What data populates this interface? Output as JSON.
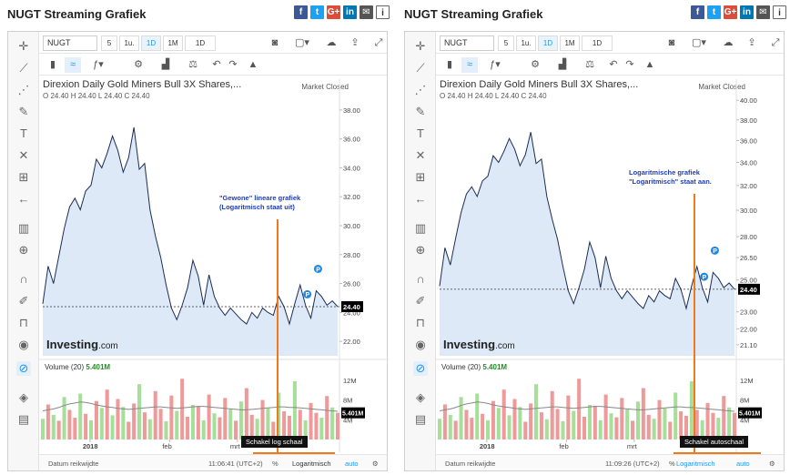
{
  "panels": [
    {
      "id": "left",
      "title": "NUGT Streaming Grafiek",
      "symbol": "NUGT",
      "timeframes": [
        "5",
        "1u.",
        "1D",
        "1M",
        "1D"
      ],
      "selected_timeframe_index": 2,
      "instrument_name": "Direxion Daily Gold Miners Bull 3X Shares,...",
      "ohlc_text": "O 24.40  H 24.40  L 24.40  C 24.40",
      "market_status": "Market Closed",
      "y_labels": [
        "38.00",
        "36.00",
        "34.00",
        "32.00",
        "30.00",
        "28.00",
        "26.00",
        "24.00",
        "22.00"
      ],
      "last_price": "24.40",
      "annotation_line1": "\"Gewone\" lineare grafiek",
      "annotation_line2": "(Logaritmisch staat uit)",
      "volume_label": "Volume (20)",
      "volume_value": "5.401M",
      "vol_axis_labels": [
        "12M",
        "8M",
        "4M"
      ],
      "x_labels": [
        "2018",
        "feb",
        "mrt"
      ],
      "range_label": "Datum reikwijdte",
      "time_label": "11:06:41 (UTC+2)",
      "percent_label": "%",
      "log_label": "Logaritmisch",
      "auto_label": "auto",
      "tooltip": "Schakel log schaal",
      "log_on": false
    },
    {
      "id": "right",
      "title": "NUGT Streaming Grafiek",
      "symbol": "NUGT",
      "timeframes": [
        "5",
        "1u.",
        "1D",
        "1M",
        "1D"
      ],
      "selected_timeframe_index": 2,
      "instrument_name": "Direxion Daily Gold Miners Bull 3X Shares,...",
      "ohlc_text": "O 24.40  H 24.40  L 24.40  C 24.40",
      "market_status": "Market Closed",
      "y_labels": [
        "40.00",
        "38.00",
        "36.00",
        "34.00",
        "32.00",
        "30.00",
        "28.00",
        "26.50",
        "25.00",
        "23.00",
        "22.00",
        "21.10"
      ],
      "last_price": "24.40",
      "annotation_line1": "Logaritmische grafiek",
      "annotation_line2": "\"Logaritmisch\" staat aan.",
      "volume_label": "Volume (20)",
      "volume_value": "5.401M",
      "vol_axis_labels": [
        "12M",
        "8M",
        "4M"
      ],
      "x_labels": [
        "2018",
        "feb",
        "mrt"
      ],
      "range_label": "Datum reikwijdte",
      "time_label": "11:09:26 (UTC+2)",
      "percent_label": "%",
      "log_label": "Logaritmisch",
      "auto_label": "auto",
      "tooltip": "Schakel autoschaal",
      "log_on": true
    }
  ],
  "brand": {
    "name": "Investing",
    "suffix": ".com"
  },
  "share_icons": [
    "facebook-icon",
    "twitter-icon",
    "google-plus-icon",
    "linkedin-icon",
    "mail-icon",
    "info-icon"
  ],
  "share_glyphs": [
    "f",
    "t",
    "G+",
    "in",
    "✉",
    "i"
  ],
  "colors": {
    "line": "#1b2d55",
    "area": "#dde9f7",
    "vol_up": "#a6df9a",
    "vol_down": "#ee9a9a",
    "highlight": "#f07a1a",
    "accent": "#2196f3"
  },
  "chart_data": [
    {
      "type": "line",
      "title": "Direxion Daily Gold Miners Bull 3X Shares,...",
      "scale": "linear",
      "ylim": [
        21,
        39
      ],
      "x_ticks": [
        "2018",
        "feb",
        "mrt"
      ],
      "values": [
        24.6,
        27.2,
        26.0,
        27.9,
        29.8,
        31.3,
        31.9,
        31.1,
        32.4,
        32.8,
        34.6,
        34.0,
        35.0,
        36.2,
        35.2,
        33.7,
        34.7,
        36.8,
        33.9,
        34.3,
        31.1,
        29.3,
        27.8,
        25.9,
        24.3,
        23.5,
        24.5,
        25.7,
        27.6,
        26.5,
        24.5,
        26.6,
        25.1,
        24.3,
        23.8,
        24.3,
        23.9,
        23.5,
        23.2,
        24.0,
        23.6,
        24.3,
        24.0,
        23.8,
        25.1,
        24.4,
        23.2,
        24.6,
        25.9,
        24.5,
        23.6,
        25.5,
        25.1,
        24.5,
        24.8,
        24.4
      ],
      "last_price": 24.4,
      "volume": {
        "ylim": [
          0,
          14
        ],
        "label": "Volume (20)",
        "values": [
          4.2,
          7.1,
          5.0,
          3.8,
          8.6,
          6.0,
          4.4,
          9.3,
          5.2,
          3.9,
          7.8,
          6.4,
          10.1,
          4.9,
          8.2,
          6.6,
          3.6,
          7.3,
          11.2,
          5.5,
          4.1,
          9.8,
          6.2,
          3.7,
          8.9,
          5.8,
          12.3,
          4.6,
          7.0,
          6.8,
          3.9,
          9.1,
          5.3,
          4.5,
          8.4,
          6.1,
          3.8,
          7.7,
          10.4,
          5.0,
          4.2,
          8.0,
          6.3,
          3.6,
          9.5,
          5.7,
          4.8,
          11.8,
          6.0,
          3.9,
          7.4,
          5.4,
          4.4,
          8.8,
          6.5,
          5.4
        ],
        "up": [
          true,
          false,
          true,
          false,
          true,
          false,
          false,
          true,
          false,
          true,
          false,
          true,
          false,
          true,
          false,
          true,
          false,
          false,
          true,
          false,
          true,
          false,
          false,
          true,
          false,
          true,
          false,
          false,
          true,
          false,
          true,
          false,
          true,
          false,
          false,
          true,
          false,
          true,
          false,
          false,
          true,
          false,
          true,
          false,
          true,
          false,
          false,
          true,
          false,
          true,
          false,
          false,
          true,
          false,
          true,
          false
        ],
        "ma": [
          5.8,
          6.0,
          6.2,
          6.5,
          6.9,
          7.2,
          7.4,
          7.6,
          7.5,
          7.3,
          7.0,
          6.8,
          6.6,
          6.5,
          6.3,
          6.2,
          6.1,
          6.2,
          6.3,
          6.4,
          6.5,
          6.6,
          6.6,
          6.5,
          6.4,
          6.3,
          6.4,
          6.5,
          6.6,
          6.7,
          6.7,
          6.6,
          6.5,
          6.4,
          6.3,
          6.2,
          6.1,
          6.0,
          6.0,
          6.1,
          6.2,
          6.3,
          6.4,
          6.5,
          6.6,
          6.6,
          6.5,
          6.5,
          6.4,
          6.3,
          6.2,
          6.1,
          6.0,
          5.9,
          5.8,
          5.7
        ]
      }
    },
    {
      "type": "line",
      "title": "Direxion Daily Gold Miners Bull 3X Shares,...",
      "scale": "log",
      "ylim": [
        20.5,
        40.5
      ],
      "x_ticks": [
        "2018",
        "feb",
        "mrt"
      ],
      "values": [
        24.6,
        27.2,
        26.0,
        27.9,
        29.8,
        31.3,
        31.9,
        31.1,
        32.4,
        32.8,
        34.6,
        34.0,
        35.0,
        36.2,
        35.2,
        33.7,
        34.7,
        36.8,
        33.9,
        34.3,
        31.1,
        29.3,
        27.8,
        25.9,
        24.3,
        23.5,
        24.5,
        25.7,
        27.6,
        26.5,
        24.5,
        26.6,
        25.1,
        24.3,
        23.8,
        24.3,
        23.9,
        23.5,
        23.2,
        24.0,
        23.6,
        24.3,
        24.0,
        23.8,
        25.1,
        24.4,
        23.2,
        24.6,
        25.9,
        24.5,
        23.6,
        25.5,
        25.1,
        24.5,
        24.8,
        24.4
      ],
      "last_price": 24.4,
      "volume": {
        "ylim": [
          0,
          14
        ],
        "label": "Volume (20)",
        "values": [
          4.2,
          7.1,
          5.0,
          3.8,
          8.6,
          6.0,
          4.4,
          9.3,
          5.2,
          3.9,
          7.8,
          6.4,
          10.1,
          4.9,
          8.2,
          6.6,
          3.6,
          7.3,
          11.2,
          5.5,
          4.1,
          9.8,
          6.2,
          3.7,
          8.9,
          5.8,
          12.3,
          4.6,
          7.0,
          6.8,
          3.9,
          9.1,
          5.3,
          4.5,
          8.4,
          6.1,
          3.8,
          7.7,
          10.4,
          5.0,
          4.2,
          8.0,
          6.3,
          3.6,
          9.5,
          5.7,
          4.8,
          11.8,
          6.0,
          3.9,
          7.4,
          5.4,
          4.4,
          8.8,
          6.5,
          5.4
        ],
        "up": [
          true,
          false,
          true,
          false,
          true,
          false,
          false,
          true,
          false,
          true,
          false,
          true,
          false,
          true,
          false,
          true,
          false,
          false,
          true,
          false,
          true,
          false,
          false,
          true,
          false,
          true,
          false,
          false,
          true,
          false,
          true,
          false,
          true,
          false,
          false,
          true,
          false,
          true,
          false,
          false,
          true,
          false,
          true,
          false,
          true,
          false,
          false,
          true,
          false,
          true,
          false,
          false,
          true,
          false,
          true,
          false
        ],
        "ma": [
          5.8,
          6.0,
          6.2,
          6.5,
          6.9,
          7.2,
          7.4,
          7.6,
          7.5,
          7.3,
          7.0,
          6.8,
          6.6,
          6.5,
          6.3,
          6.2,
          6.1,
          6.2,
          6.3,
          6.4,
          6.5,
          6.6,
          6.6,
          6.5,
          6.4,
          6.3,
          6.4,
          6.5,
          6.6,
          6.7,
          6.7,
          6.6,
          6.5,
          6.4,
          6.3,
          6.2,
          6.1,
          6.0,
          6.0,
          6.1,
          6.2,
          6.3,
          6.4,
          6.5,
          6.6,
          6.6,
          6.5,
          6.5,
          6.4,
          6.3,
          6.2,
          6.1,
          6.0,
          5.9,
          5.8,
          5.7
        ]
      }
    }
  ]
}
